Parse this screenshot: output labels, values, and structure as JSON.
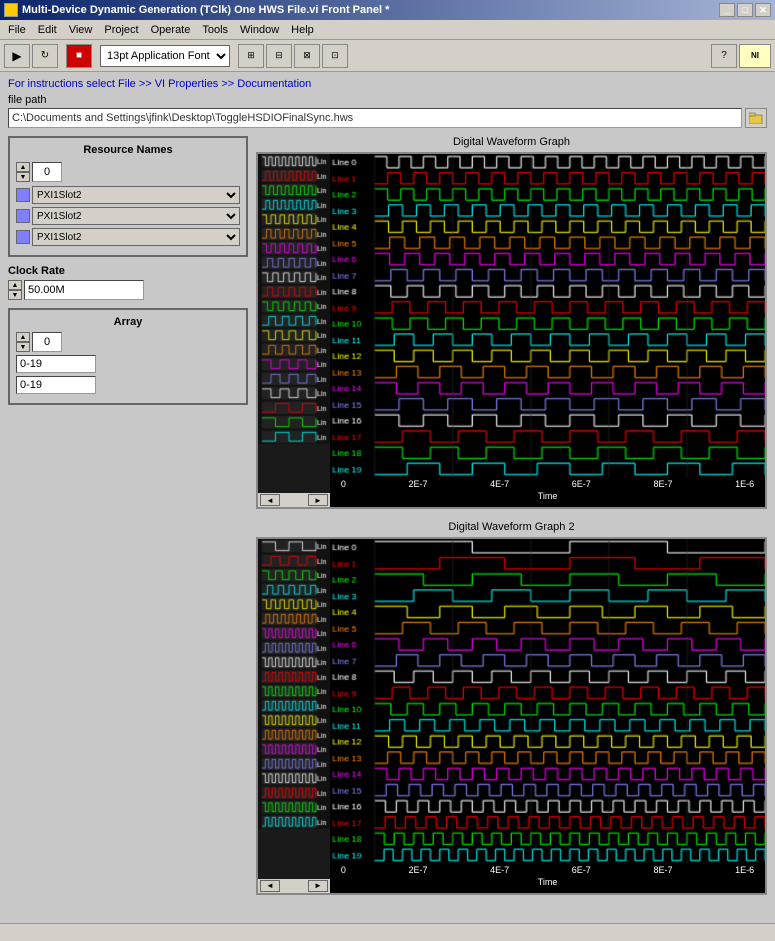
{
  "window": {
    "title": "Multi-Device Dynamic Generation (TClk) One HWS File.vi Front Panel *",
    "icon_label": "NI"
  },
  "menubar": {
    "items": [
      "File",
      "Edit",
      "View",
      "Project",
      "Operate",
      "Tools",
      "Window",
      "Help"
    ]
  },
  "toolbar": {
    "font_label": "13pt Application Font"
  },
  "instructions_link": "For instructions select File >> VI Properties >> Documentation",
  "file_path": {
    "label": "file path",
    "value": "C:\\Documents and Settings\\jfink\\Desktop\\ToggleHSDIOFinalSync.hws"
  },
  "resource_names": {
    "title": "Resource Names",
    "numeric_value": "0",
    "dropdowns": [
      "PXI1Slot2",
      "PXI1Slot2",
      "PXI1Slot2"
    ]
  },
  "clock_rate": {
    "label": "Clock Rate",
    "value": "50.00M"
  },
  "array": {
    "label": "Array",
    "index": "0",
    "values": [
      "0-19",
      "0-19"
    ]
  },
  "graph1": {
    "title": "Digital Waveform Graph",
    "lines": [
      "Line 0",
      "Line 1",
      "Line 2",
      "Line 3",
      "Line 4",
      "Line 5",
      "Line 6",
      "Line 7",
      "Line 8",
      "Line 9",
      "Line 10",
      "Line 11",
      "Line 12",
      "Line 13",
      "Line 14",
      "Line 15",
      "Line 16",
      "Line 17",
      "Line 18",
      "Line 19"
    ],
    "x_labels": [
      "0",
      "2E-7",
      "4E-7",
      "6E-7",
      "8E-7",
      "1E-6"
    ],
    "x_axis_title": "Time",
    "line_colors": [
      "#ffffff",
      "#ff0000",
      "#00ff00",
      "#00ffff",
      "#ffff00",
      "#ff8800",
      "#ff00ff",
      "#8888ff",
      "#ffffff",
      "#ff0000",
      "#00ff00",
      "#00ffff",
      "#ffff00",
      "#ff8800",
      "#ff00ff",
      "#8888ff",
      "#ffffff",
      "#ff0000",
      "#00ff00",
      "#00ffff"
    ]
  },
  "graph2": {
    "title": "Digital Waveform Graph 2",
    "lines": [
      "Line 0",
      "Line 1",
      "Line 2",
      "Line 3",
      "Line 4",
      "Line 5",
      "Line 6",
      "Line 7",
      "Line 8",
      "Line 9",
      "Line 10",
      "Line 11",
      "Line 12",
      "Line 13",
      "Line 14",
      "Line 15",
      "Line 16",
      "Line 17",
      "Line 18",
      "Line 19"
    ],
    "x_labels": [
      "0",
      "2E-7",
      "4E-7",
      "6E-7",
      "8E-7",
      "1E-6"
    ],
    "x_axis_title": "Time",
    "line_colors": [
      "#ffffff",
      "#ff0000",
      "#00ff00",
      "#00ffff",
      "#ffff00",
      "#ff8800",
      "#ff00ff",
      "#8888ff",
      "#ffffff",
      "#ff0000",
      "#00ff00",
      "#00ffff",
      "#ffff00",
      "#ff8800",
      "#ff00ff",
      "#8888ff",
      "#ffffff",
      "#ff0000",
      "#00ff00",
      "#00ffff"
    ]
  }
}
